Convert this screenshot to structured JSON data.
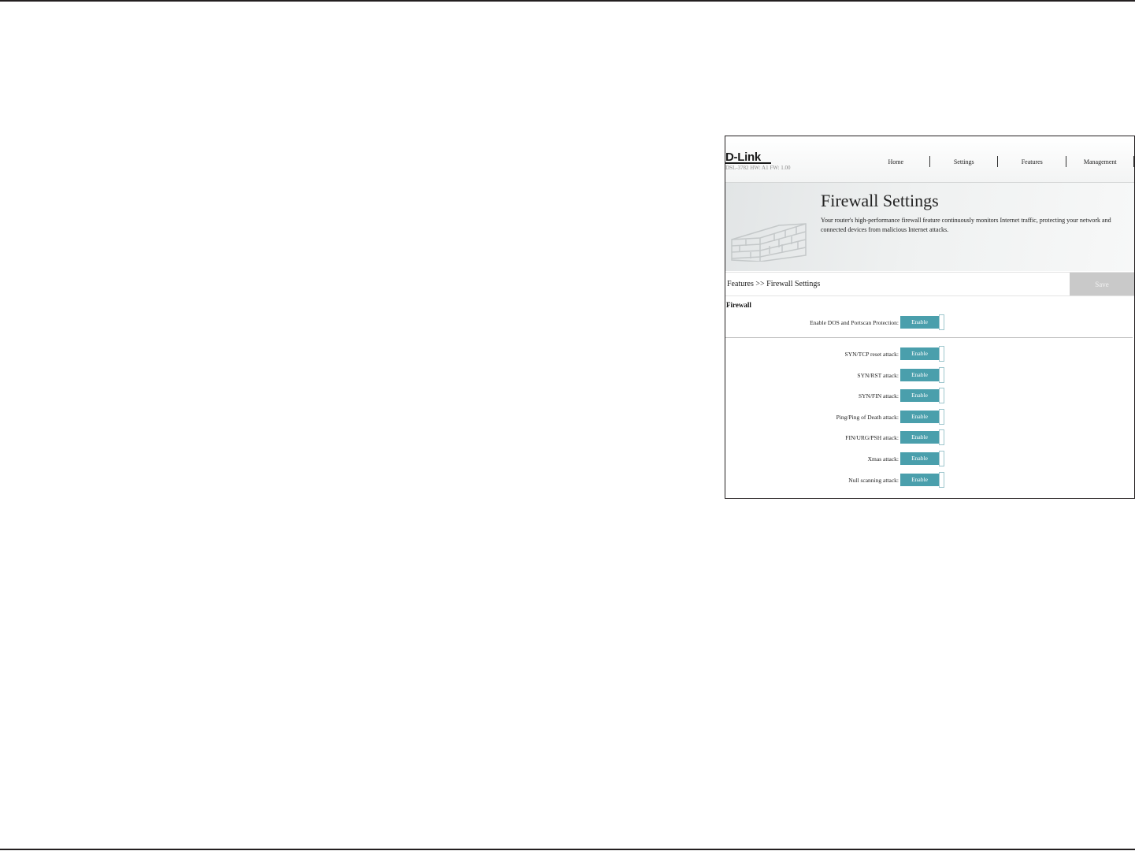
{
  "header": {
    "logo": "D-Link",
    "model": "DSL-3782  HW: A1  FW: 1.00",
    "nav": [
      "Home",
      "Settings",
      "Features",
      "Management"
    ]
  },
  "hero": {
    "title": "Firewall Settings",
    "description": "Your router's high-performance firewall feature continuously monitors Internet traffic, protecting your network and connected devices from malicious Internet attacks."
  },
  "breadcrumb": "Features >> Firewall Settings",
  "save_label": "Save",
  "section_title": "Firewall",
  "dos": {
    "label": "Enable DOS and Portscan Protection:",
    "state": "Enable"
  },
  "attacks": [
    {
      "label": "SYN/TCP reset attack:",
      "state": "Enable"
    },
    {
      "label": "SYN/RST attack:",
      "state": "Enable"
    },
    {
      "label": "SYN/FIN attack:",
      "state": "Enable"
    },
    {
      "label": "Ping/Ping of Death attack:",
      "state": "Enable"
    },
    {
      "label": "FIN/URG/PSH attack:",
      "state": "Enable"
    },
    {
      "label": "Xmas attack:",
      "state": "Enable"
    },
    {
      "label": "Null scanning attack:",
      "state": "Enable"
    }
  ],
  "colors": {
    "toggle": "#4a9fac",
    "save_disabled": "#c9c9c9"
  }
}
